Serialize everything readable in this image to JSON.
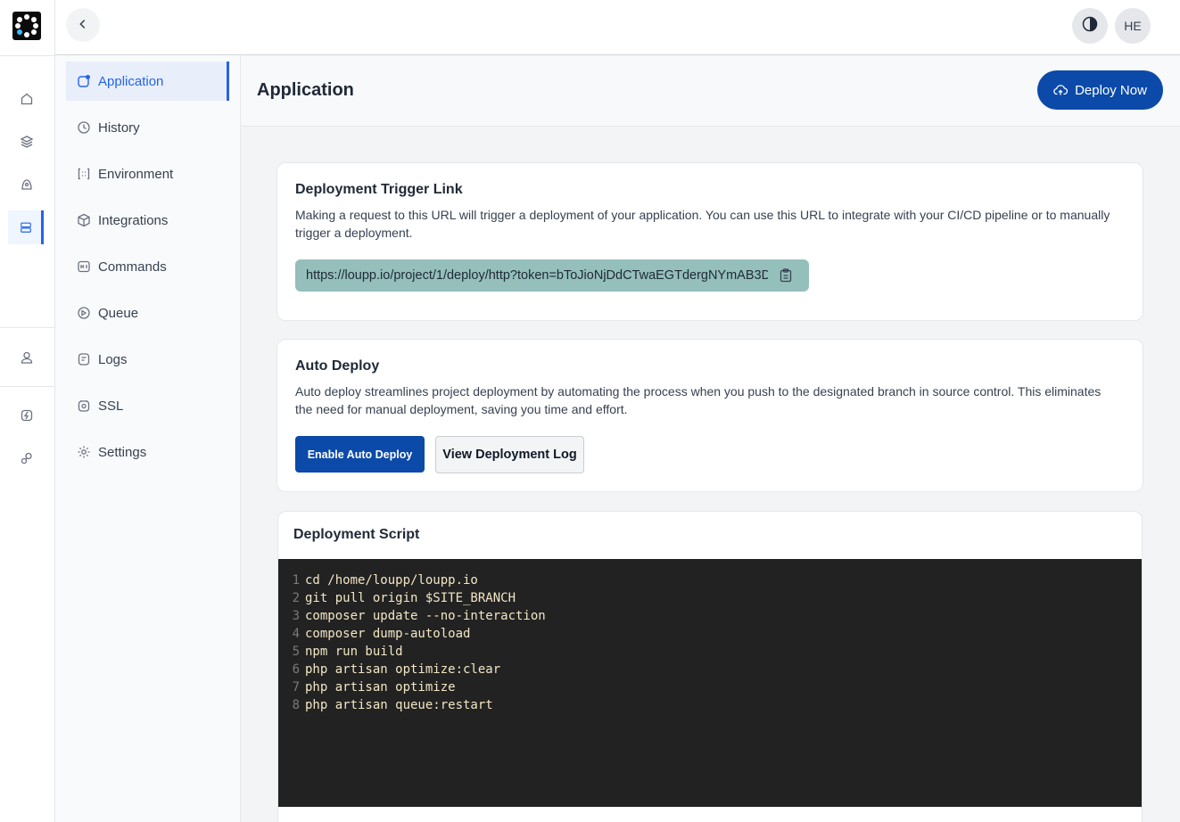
{
  "topbar": {
    "avatar_initials": "HE"
  },
  "rail": {
    "icons": [
      "home-icon",
      "layers-icon",
      "rocket-icon",
      "server-icon",
      "user-icon",
      "bolt-icon",
      "key-icon"
    ],
    "active": "server-icon"
  },
  "subnav": {
    "items": [
      {
        "label": "Application",
        "icon": "application-icon",
        "active": true
      },
      {
        "label": "History",
        "icon": "history-icon"
      },
      {
        "label": "Environment",
        "icon": "environment-icon"
      },
      {
        "label": "Integrations",
        "icon": "cube-icon"
      },
      {
        "label": "Commands",
        "icon": "terminal-icon"
      },
      {
        "label": "Queue",
        "icon": "queue-icon"
      },
      {
        "label": "Logs",
        "icon": "logs-icon"
      },
      {
        "label": "SSL",
        "icon": "lock-icon"
      },
      {
        "label": "Settings",
        "icon": "gear-icon"
      }
    ]
  },
  "page": {
    "title": "Application",
    "deploy_label": "Deploy Now"
  },
  "trigger": {
    "title": "Deployment Trigger Link",
    "description": "Making a request to this URL will trigger a deployment of your application. You can use this URL to integrate with your CI/CD pipeline or to manually trigger a deployment.",
    "url": "https://loupp.io/project/1/deploy/http?token=bToJioNjDdCTwaEGTdergNYmAB3D"
  },
  "auto_deploy": {
    "title": "Auto Deploy",
    "description": "Auto deploy streamlines project deployment by automating the process when you push to the designated branch in source control. This eliminates the need for manual deployment, saving you time and effort.",
    "enable_label": "Enable Auto Deploy",
    "log_label": "View Deployment Log"
  },
  "script": {
    "title": "Deployment Script",
    "lines": [
      {
        "n": "1",
        "text": "cd /home/loupp/loupp.io"
      },
      {
        "n": "2",
        "text": "git pull origin $SITE_BRANCH"
      },
      {
        "n": "3",
        "text": "composer update --no-interaction"
      },
      {
        "n": "4",
        "text": "composer dump-autoload"
      },
      {
        "n": "5",
        "text": "npm run build"
      },
      {
        "n": "6",
        "text": "php artisan optimize:clear"
      },
      {
        "n": "7",
        "text": "php artisan optimize"
      },
      {
        "n": "8",
        "text": "php artisan queue:restart"
      }
    ]
  },
  "colors": {
    "accent": "#2563eb",
    "primary_button": "#0b4aa8",
    "url_box": "#94bfbb",
    "code_bg": "#222222"
  }
}
